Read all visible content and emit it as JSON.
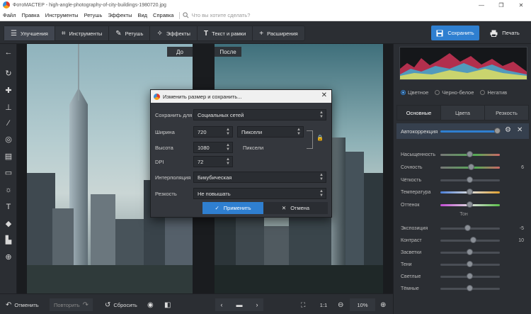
{
  "window": {
    "title": "ФотоМАСТЕР - high-angle-photography-of-city-buildings-1980720.jpg"
  },
  "menu": {
    "items": [
      "Файл",
      "Правка",
      "Инструменты",
      "Ретушь",
      "Эффекты",
      "Вид",
      "Справка"
    ],
    "search_placeholder": "Что вы хотите сделать?"
  },
  "toolbar": {
    "tabs": [
      {
        "label": "Улучшения",
        "icon": "sliders-icon"
      },
      {
        "label": "Инструменты",
        "icon": "crop-icon"
      },
      {
        "label": "Ретушь",
        "icon": "brush-icon"
      },
      {
        "label": "Эффекты",
        "icon": "magic-wand-icon"
      },
      {
        "label": "Текст и рамки",
        "icon": "text-icon"
      },
      {
        "label": "Расширения",
        "icon": "plus-icon"
      }
    ],
    "save_label": "Сохранить",
    "print_label": "Печать"
  },
  "canvas": {
    "before_label": "До",
    "after_label": "После"
  },
  "dialog": {
    "title": "Изменить размер и сохранить...",
    "save_for_label": "Сохранить для",
    "save_for_value": "Социальных сетей",
    "width_label": "Ширина",
    "width_value": "720",
    "width_unit": "Пиксели",
    "height_label": "Высота",
    "height_value": "1080",
    "height_unit": "Пиксели",
    "dpi_label": "DPI",
    "dpi_value": "72",
    "interp_label": "Интерполяция",
    "interp_value": "Бикубическая",
    "sharp_label": "Резкость",
    "sharp_value": "Не повышать",
    "apply_label": "Применить",
    "cancel_label": "Отмена"
  },
  "panel": {
    "modes": [
      {
        "label": "Цветное",
        "selected": true
      },
      {
        "label": "Черно-белое",
        "selected": false
      },
      {
        "label": "Негатив",
        "selected": false
      }
    ],
    "tabs": [
      "Основные",
      "Цвета",
      "Резкость"
    ],
    "autocorrect_label": "Автокоррекция",
    "sliders": [
      {
        "label": "Насыщенность",
        "value": "",
        "level": 0.5
      },
      {
        "label": "Сочность",
        "value": "6",
        "level": 0.52
      },
      {
        "label": "Чёткость",
        "value": "",
        "level": 0.5
      },
      {
        "label": "Температура",
        "value": "",
        "level": 0.5
      },
      {
        "label": "Оттенок",
        "value": "",
        "level": 0.5
      }
    ],
    "tone_label": "Тон",
    "tone_sliders": [
      {
        "label": "Экспозиция",
        "value": "-5",
        "level": 0.47
      },
      {
        "label": "Контраст",
        "value": "10",
        "level": 0.55
      },
      {
        "label": "Засветки",
        "value": "",
        "level": 0.5
      },
      {
        "label": "Тени",
        "value": "",
        "level": 0.5
      },
      {
        "label": "Светлые",
        "value": "",
        "level": 0.5
      },
      {
        "label": "Тёмные",
        "value": "",
        "level": 0.5
      }
    ]
  },
  "bottom": {
    "undo_label": "Отменить",
    "redo_label": "Повторить",
    "reset_label": "Сбросить",
    "zoom_ratio": "1:1",
    "zoom_value": "10%"
  }
}
